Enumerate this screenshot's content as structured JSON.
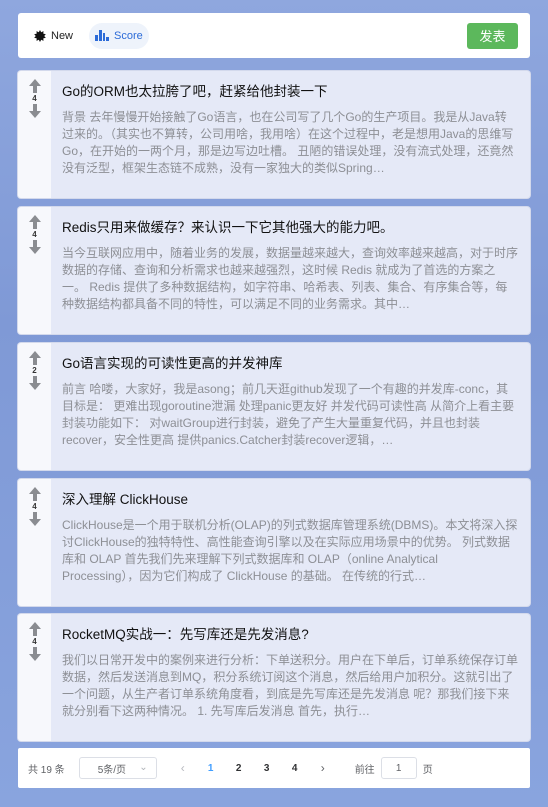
{
  "toolbar": {
    "sort_new_label": "New",
    "sort_score_label": "Score",
    "publish_label": "发表"
  },
  "posts": [
    {
      "score": "4",
      "title": "Go的ORM也太拉胯了吧，赶紧给他封装一下",
      "desc": "背景 去年慢慢开始接触了Go语言，也在公司写了几个Go的生产项目。我是从Java转过来的。（其实也不算转，公司用啥，我用啥）在这个过程中，老是想用Java的思维写Go，在开始的一两个月，那是边写边吐槽。 丑陋的错误处理，没有流式处理，还竟然没有泛型，框架生态链不成熟，没有一家独大的类似Spring…"
    },
    {
      "score": "4",
      "title": "Redis只用来做缓存？来认识一下它其他强大的能力吧。",
      "desc": "当今互联网应用中，随着业务的发展，数据量越来越大，查询效率越来越高，对于时序数据的存储、查询和分析需求也越来越强烈，这时候 Redis 就成为了首选的方案之一。 Redis 提供了多种数据结构，如字符串、哈希表、列表、集合、有序集合等，每种数据结构都具备不同的特性，可以满足不同的业务需求。其中…"
    },
    {
      "score": "2",
      "title": "Go语言实现的可读性更高的并发神库",
      "desc": "前言 哈喽，大家好，我是asong；前几天逛github发现了一个有趣的并发库-conc，其目标是： 更难出现goroutine泄漏 处理panic更友好 并发代码可读性高 从简介上看主要封装功能如下： 对waitGroup进行封装，避免了产生大量重复代码，并且也封装recover，安全性更高 提供panics.Catcher封装recover逻辑，…"
    },
    {
      "score": "4",
      "title": "深入理解 ClickHouse",
      "desc": "ClickHouse是一个用于联机分析(OLAP)的列式数据库管理系统(DBMS)。本文将深入探讨ClickHouse的独特特性、高性能查询引擎以及在实际应用场景中的优势。 列式数据库和 OLAP 首先我们先来理解下列式数据库和 OLAP（online Analytical Processing），因为它们构成了 ClickHouse 的基础。 在传统的行式…"
    },
    {
      "score": "4",
      "title": "RocketMQ实战一：先写库还是先发消息?",
      "desc": "我们以日常开发中的案例来进行分析：下单送积分。用户在下单后，订单系统保存订单数据，然后发送消息到MQ，积分系统订阅这个消息，然后给用户加积分。这就引出了一个问题，从生产者订单系统角度看，到底是先写库还是先发消息 呢？那我们接下来就分别看下这两种情况。 1. 先写库后发消息 首先，执行…"
    }
  ],
  "pagination": {
    "total_label": "共 19 条",
    "page_size_label": "5条/页",
    "pages": [
      "1",
      "2",
      "3",
      "4"
    ],
    "current_page": "1",
    "goto_label": "前往",
    "goto_value": "1",
    "goto_suffix": "页"
  }
}
